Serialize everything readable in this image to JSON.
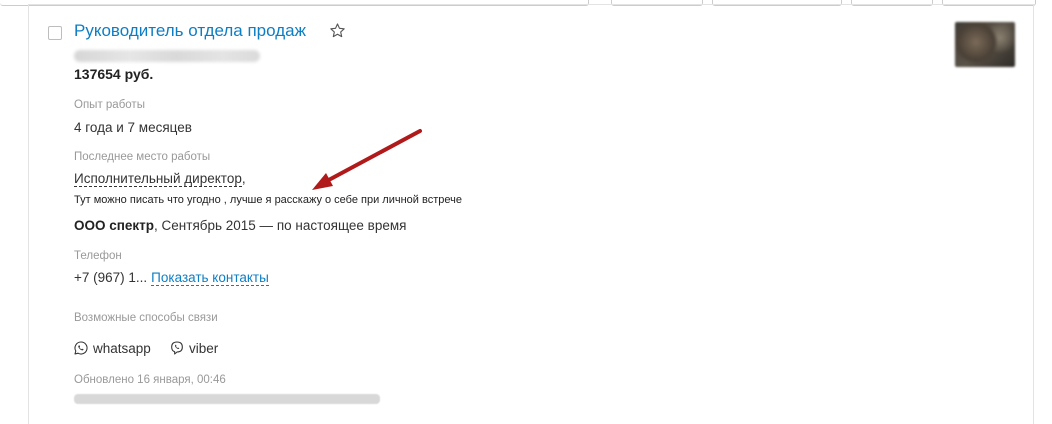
{
  "resume": {
    "title": "Руководитель отдела продаж",
    "salary": "137654 руб.",
    "experience_label": "Опыт работы",
    "experience_value": "4 года и 7 месяцев",
    "last_job_label": "Последнее место работы",
    "position": "Исполнительный директор",
    "position_suffix": ",",
    "note": "Тут можно писать что угодно , лучше я расскажу о себе при личной встрече",
    "company_name": "ООО спектр",
    "company_period": ", Сентябрь 2015 — по настоящее время",
    "phone_label": "Телефон",
    "phone_value": "+7 (967) 1...",
    "show_contacts": "Показать контакты",
    "contact_methods_label": "Возможные способы связи",
    "contact_methods": [
      "whatsapp",
      "viber"
    ],
    "updated": "Обновлено 16 января, 00:46"
  },
  "colors": {
    "link": "#0e7ec4",
    "muted": "#999999",
    "arrow": "#b01a1a"
  },
  "icons": {
    "star": "star-icon",
    "whatsapp": "whatsapp-icon",
    "viber": "viber-icon"
  }
}
